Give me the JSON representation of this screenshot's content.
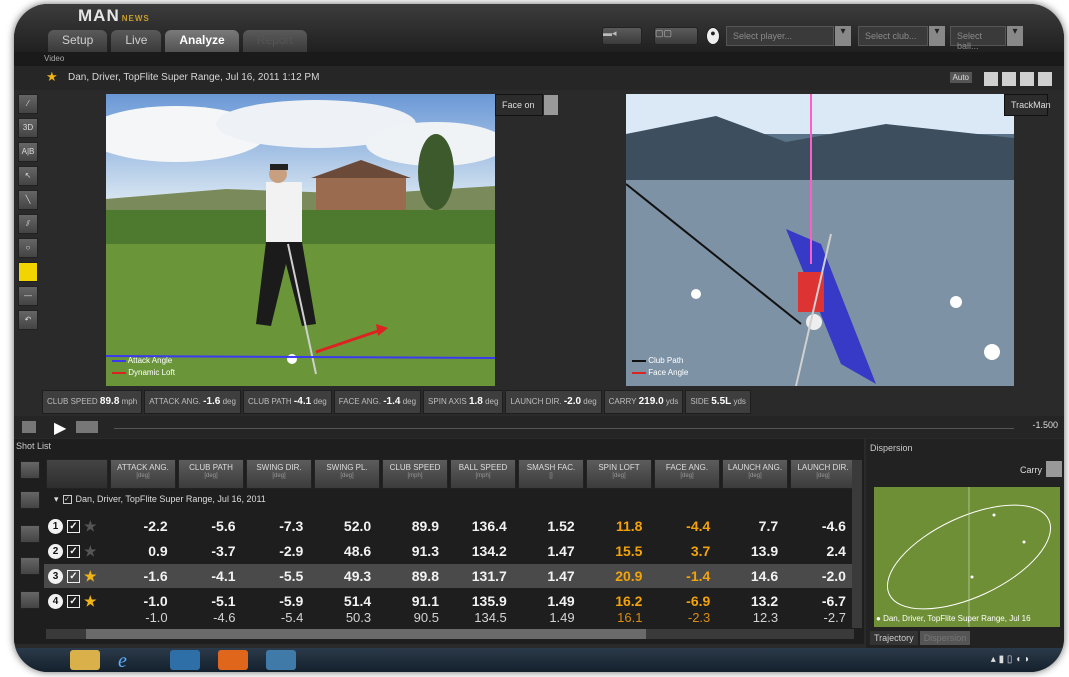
{
  "app": {
    "logo_text": "MAN",
    "logo_sub": "NEWS"
  },
  "tabs": [
    "Setup",
    "Live",
    "Analyze",
    "Report"
  ],
  "toolbar": {
    "player_placeholder": "Select player...",
    "club_placeholder": "Select club...",
    "ball_placeholder": "Select ball..."
  },
  "video_section_label": "Video",
  "session_title": "Dan, Driver, TopFlite Super Range, Jul 16, 2011 1:12 PM",
  "auto_label": "Auto",
  "left_tools": [
    "3D",
    "A|B"
  ],
  "video_left": {
    "view": "Face on",
    "legend": [
      "Attack Angle",
      "Dynamic Loft"
    ]
  },
  "video_right": {
    "view": "TrackMan",
    "legend": [
      "Club Path",
      "Face Angle"
    ]
  },
  "metrics": [
    {
      "label": "CLUB SPEED",
      "value": "89.8",
      "unit": "mph"
    },
    {
      "label": "ATTACK ANG.",
      "value": "-1.6",
      "unit": "deg"
    },
    {
      "label": "CLUB PATH",
      "value": "-4.1",
      "unit": "deg"
    },
    {
      "label": "FACE ANG.",
      "value": "-1.4",
      "unit": "deg"
    },
    {
      "label": "SPIN AXIS",
      "value": "1.8",
      "unit": "deg"
    },
    {
      "label": "LAUNCH DIR.",
      "value": "-2.0",
      "unit": "deg"
    },
    {
      "label": "CARRY",
      "value": "219.0",
      "unit": "yds"
    },
    {
      "label": "SIDE",
      "value": "5.5L",
      "unit": "yds"
    }
  ],
  "timeline_value": "-1.500",
  "shot_list": {
    "title": "Shot List",
    "columns": [
      {
        "label": "ATTACK ANG.",
        "unit": "[deg]"
      },
      {
        "label": "CLUB PATH",
        "unit": "[deg]"
      },
      {
        "label": "SWING DIR.",
        "unit": "[deg]"
      },
      {
        "label": "SWING PL.",
        "unit": "[deg]"
      },
      {
        "label": "CLUB SPEED",
        "unit": "[mph]"
      },
      {
        "label": "BALL SPEED",
        "unit": "[mph]"
      },
      {
        "label": "SMASH FAC.",
        "unit": "[]"
      },
      {
        "label": "SPIN LOFT",
        "unit": "[deg]"
      },
      {
        "label": "FACE ANG.",
        "unit": "[deg]"
      },
      {
        "label": "LAUNCH ANG.",
        "unit": "[deg]"
      },
      {
        "label": "LAUNCH DIR.",
        "unit": "[deg]"
      }
    ],
    "group_label": "Dan, Driver, TopFlite Super Range, Jul 16, 2011",
    "rows": [
      {
        "num": "1",
        "starred": false,
        "values": [
          "-2.2",
          "-5.6",
          "-7.3",
          "52.0",
          "89.9",
          "136.4",
          "1.52",
          "11.8",
          "-4.4",
          "7.7",
          "-4.6"
        ]
      },
      {
        "num": "2",
        "starred": false,
        "values": [
          "0.9",
          "-3.7",
          "-2.9",
          "48.6",
          "91.3",
          "134.2",
          "1.47",
          "15.5",
          "3.7",
          "13.9",
          "2.4"
        ]
      },
      {
        "num": "3",
        "starred": true,
        "values": [
          "-1.6",
          "-4.1",
          "-5.5",
          "49.3",
          "89.8",
          "131.7",
          "1.47",
          "20.9",
          "-1.4",
          "14.6",
          "-2.0"
        ]
      },
      {
        "num": "4",
        "starred": true,
        "values": [
          "-1.0",
          "-5.1",
          "-5.9",
          "51.4",
          "91.1",
          "135.9",
          "1.49",
          "16.2",
          "-6.9",
          "13.2",
          "-6.7"
        ]
      }
    ],
    "averages": [
      "-1.0",
      "-4.6",
      "-5.4",
      "50.3",
      "90.5",
      "134.5",
      "1.49",
      "16.1",
      "-2.3",
      "12.3",
      "-2.7"
    ],
    "highlight_columns": [
      7,
      8
    ]
  },
  "dispersion": {
    "title": "Dispersion",
    "mode": "Carry",
    "legend": "Dan, Driver, TopFlite Super Range, Jul 16",
    "tabs": [
      "Trajectory",
      "Dispersion"
    ]
  },
  "colors": {
    "accent_orange": "#f2a30b",
    "star_yellow": "#f0b414",
    "tool_yellow": "#f2d400"
  }
}
